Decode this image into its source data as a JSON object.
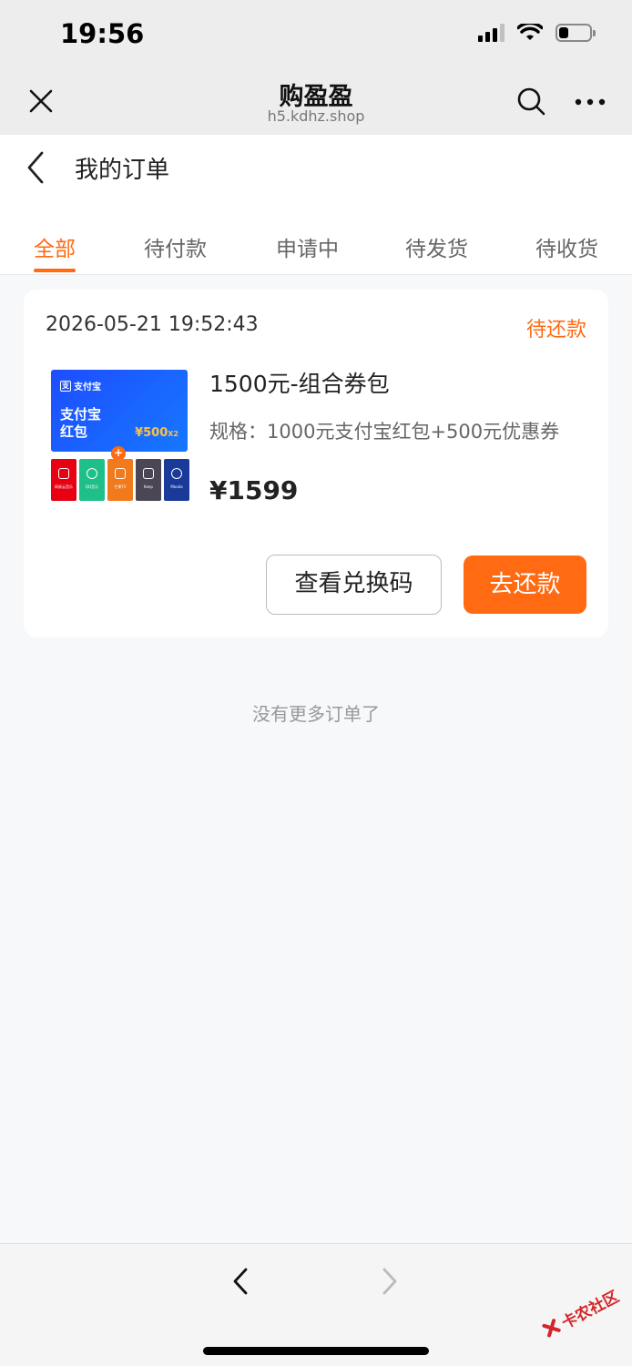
{
  "status_bar": {
    "time": "19:56"
  },
  "browser": {
    "title": "购盈盈",
    "url": "h5.kdhz.shop"
  },
  "page": {
    "title": "我的订单"
  },
  "tabs": [
    {
      "label": "全部",
      "active": true
    },
    {
      "label": "待付款",
      "active": false
    },
    {
      "label": "申请中",
      "active": false
    },
    {
      "label": "待发货",
      "active": false
    },
    {
      "label": "待收货",
      "active": false
    }
  ],
  "order": {
    "datetime": "2026-05-21 19:52:43",
    "status": "待还款",
    "product": {
      "name": "1500元-组合券包",
      "spec": "规格：1000元支付宝红包+500元优惠券",
      "price": "¥1599",
      "image": {
        "brand": "支付宝",
        "brand_en": "ALIPAY",
        "headline_line1": "支付宝",
        "headline_line2": "红包",
        "amount": "¥500",
        "multiplier": "X2",
        "plus": "+",
        "tiles": [
          {
            "label": "网易云音乐",
            "color": "#e60012"
          },
          {
            "label": "QQ音乐",
            "color": "#1fbf8a"
          },
          {
            "label": "芒果TV",
            "color": "#f07a1c"
          },
          {
            "label": "Keep",
            "color": "#4a4654"
          },
          {
            "label": "Mooda",
            "color": "#1a3a9a"
          }
        ]
      }
    },
    "buttons": {
      "view_code": "查看兑换码",
      "repay": "去还款"
    }
  },
  "list_end_text": "没有更多订单了",
  "watermark": {
    "text": "卡农社区"
  },
  "colors": {
    "accent": "#ff6a13",
    "alipay_blue": "#1677ff"
  }
}
